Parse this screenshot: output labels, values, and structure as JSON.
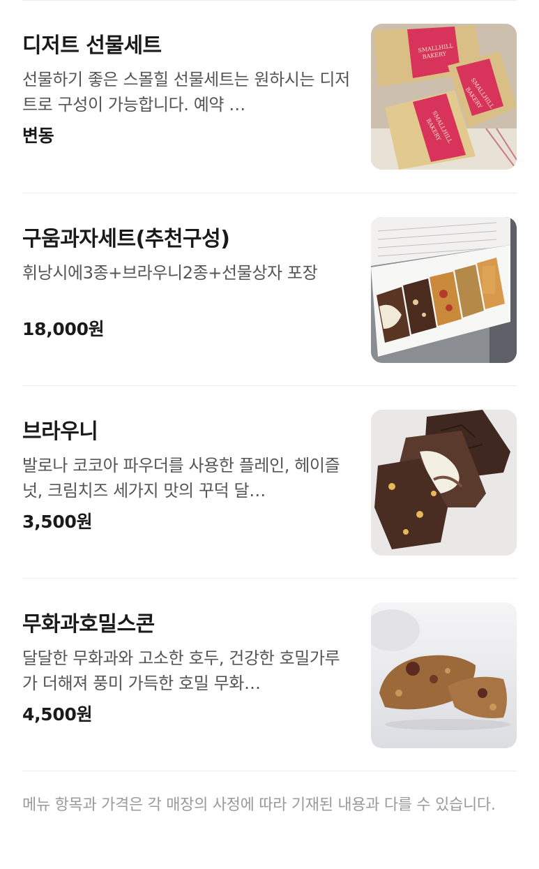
{
  "menu": {
    "items": [
      {
        "name": "디저트 선물세트",
        "description": "선물하기 좋은 스몰힐 선물세트는 원하시는 디저트로 구성이 가능합니다. 예약 …",
        "price": "변동",
        "image_icon": "gift-box-photo",
        "image_text": [
          "SMALLHILL",
          "BAKERY"
        ]
      },
      {
        "name": "구움과자세트(추천구성)",
        "description": "휘낭시에3종+브라우니2종+선물상자 포장",
        "price": "18,000원",
        "image_icon": "baked-goods-box-photo"
      },
      {
        "name": "브라우니",
        "description": "발로나 코코아 파우더를 사용한 플레인, 헤이즐넛, 크림치즈 세가지 맛의 꾸덕 달…",
        "price": "3,500원",
        "image_icon": "brownie-photo"
      },
      {
        "name": "무화과호밀스콘",
        "description": "달달한 무화과와 고소한 호두, 건강한 호밀가루가 더해져 풍미 가득한 호밀 무화…",
        "price": "4,500원",
        "image_icon": "scone-photo"
      }
    ]
  },
  "footer": {
    "note": "메뉴 항목과 가격은 각 매장의 사정에 따라 기재된 내용과 다를 수 있습니다."
  },
  "colors": {
    "text_primary": "#1a1a1a",
    "text_secondary": "#555555",
    "text_muted": "#9a9a9a",
    "divider": "#ececec",
    "box_red": "#d8335a",
    "box_kraft": "#d9bf86"
  }
}
